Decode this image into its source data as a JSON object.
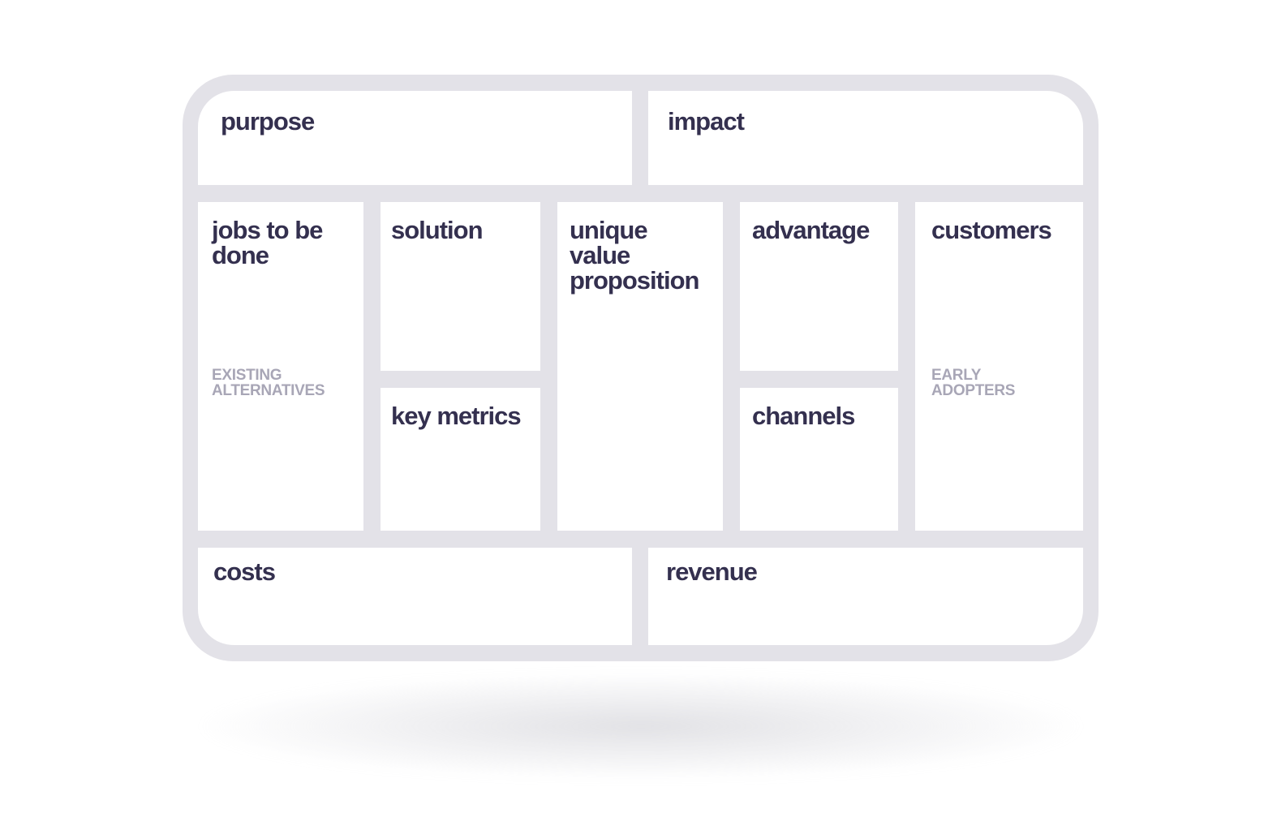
{
  "canvas": {
    "purpose": {
      "title": "purpose"
    },
    "impact": {
      "title": "impact"
    },
    "jobs": {
      "title": "jobs to be\ndone",
      "subtitle": "EXISTING\nALTERNATIVES"
    },
    "solution": {
      "title": "solution"
    },
    "key_metrics": {
      "title": "key metrics"
    },
    "uvp": {
      "title": "unique\nvalue\nproposition"
    },
    "advantage": {
      "title": "advantage"
    },
    "channels": {
      "title": "channels"
    },
    "customers": {
      "title": "customers",
      "subtitle": "EARLY\nADOPTERS"
    },
    "costs": {
      "title": "costs"
    },
    "revenue": {
      "title": "revenue"
    }
  },
  "colors": {
    "frame": "#e3e2e8",
    "cell_background": "#ffffff",
    "title_text": "#34304f",
    "subtitle_text": "#a8a6b6"
  }
}
